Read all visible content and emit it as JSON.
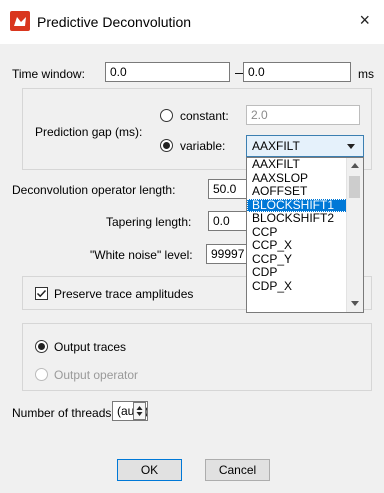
{
  "window": {
    "title": "Predictive Deconvolution",
    "close_glyph": "×",
    "accent": "#d9361e"
  },
  "time_window": {
    "label": "Time window:",
    "start": "0.0",
    "end": "0.0",
    "separator": "—",
    "unit": "ms"
  },
  "prediction_gap": {
    "label": "Prediction gap (ms):",
    "constant_label": "constant:",
    "constant_value": "2.0",
    "variable_label": "variable:",
    "variable_value": "AAXFILT",
    "selected": "variable"
  },
  "dropdown": {
    "options": [
      "AAXFILT",
      "AAXSLOP",
      "AOFFSET",
      "BLOCKSHIFT1",
      "BLOCKSHIFT2",
      "CCP",
      "CCP_X",
      "CCP_Y",
      "CDP",
      "CDP_X"
    ],
    "highlighted": "BLOCKSHIFT1"
  },
  "operator_length": {
    "label": "Deconvolution operator length:",
    "value": "50.0"
  },
  "tapering_length": {
    "label": "Tapering length:",
    "value": "0.0"
  },
  "white_noise": {
    "label": "\"White noise\" level:",
    "value": "99997"
  },
  "preserve": {
    "label": "Preserve trace amplitudes",
    "checked": true
  },
  "output": {
    "traces_label": "Output traces",
    "operator_label": "Output operator",
    "selected": "traces"
  },
  "threads": {
    "label": "Number of threads:",
    "value": "(auto)"
  },
  "buttons": {
    "ok": "OK",
    "cancel": "Cancel"
  }
}
